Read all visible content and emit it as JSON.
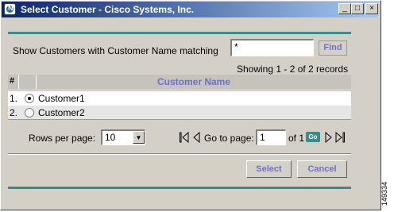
{
  "window": {
    "title": "Select Customer - Cisco Systems, Inc.",
    "controls": {
      "minimize": "_",
      "maximize": "□",
      "close": "×"
    }
  },
  "filter": {
    "label": "Show Customers with Customer Name matching",
    "value": "*",
    "find_label": "Find"
  },
  "status": {
    "showing": "Showing 1 - 2 of 2 records"
  },
  "table": {
    "headers": {
      "index": "#",
      "name": "Customer Name"
    },
    "rows": [
      {
        "index": "1.",
        "name": "Customer1",
        "selected": true
      },
      {
        "index": "2.",
        "name": "Customer2",
        "selected": false
      }
    ]
  },
  "pagination": {
    "rows_per_page_label": "Rows per page:",
    "rows_per_page_value": "10",
    "goto_label": "Go to page:",
    "page_value": "1",
    "of_label": "of 1",
    "go_label": "Go"
  },
  "actions": {
    "select_label": "Select",
    "cancel_label": "Cancel"
  },
  "figure_id": "149334",
  "colors": {
    "accent_teal": "#3b8a8c",
    "label_blue": "#6c6fcf",
    "title_bar": "#0a246a"
  },
  "icons": [
    "app-icon",
    "first-page-icon",
    "prev-page-icon",
    "next-page-icon",
    "last-page-icon",
    "dropdown-arrow-icon"
  ]
}
